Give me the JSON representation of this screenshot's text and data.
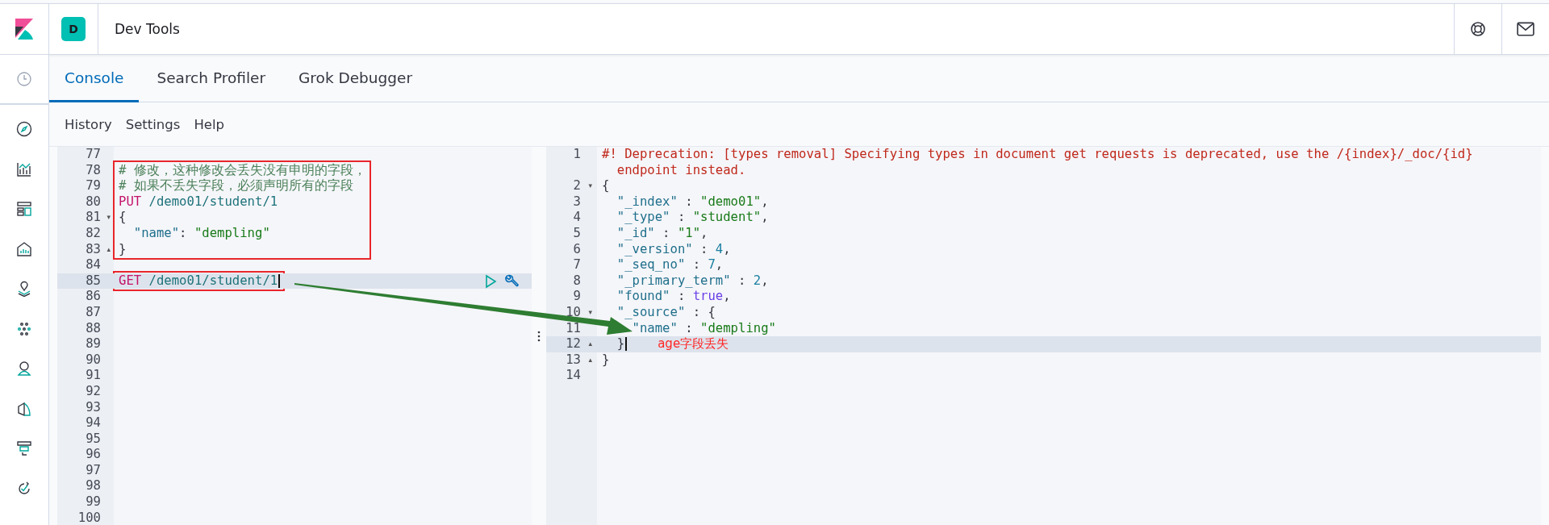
{
  "header": {
    "avatar": "D",
    "title": "Dev Tools"
  },
  "tabs": [
    {
      "label": "Console",
      "selected": true
    },
    {
      "label": "Search Profiler",
      "selected": false
    },
    {
      "label": "Grok Debugger",
      "selected": false
    }
  ],
  "menu": [
    "History",
    "Settings",
    "Help"
  ],
  "request_editor": {
    "blocks": [
      {
        "boxed": false,
        "lines": [
          {
            "number": "77",
            "active": false
          }
        ]
      },
      {
        "boxed": true,
        "lines": [
          {
            "number": "78",
            "active": false,
            "tokens": [
              {
                "kind": "comment",
                "text": "# 修改，这种修改会丢失没有申明的字段，"
              }
            ]
          },
          {
            "number": "79",
            "active": false,
            "tokens": [
              {
                "kind": "comment",
                "text": "# 如果不丢失字段，必须声明所有的字段"
              }
            ]
          },
          {
            "number": "80",
            "active": false,
            "tokens": [
              {
                "kind": "method",
                "text": "PUT"
              },
              {
                "kind": "path",
                "text": " /demo01/student/1"
              }
            ]
          },
          {
            "number": "81",
            "active": false,
            "fold": "▾",
            "tokens": [
              {
                "kind": "punct",
                "text": "{"
              }
            ]
          },
          {
            "number": "82",
            "active": false,
            "tokens": [
              {
                "kind": "key",
                "text": "  \"name\""
              },
              {
                "kind": "punct",
                "text": ": "
              },
              {
                "kind": "string",
                "text": "\"dempling\""
              }
            ]
          },
          {
            "number": "83",
            "active": false,
            "fold": "▴",
            "tokens": [
              {
                "kind": "punct",
                "text": "}"
              }
            ]
          }
        ]
      },
      {
        "boxed": false,
        "lines": [
          {
            "number": "84",
            "active": false
          }
        ]
      },
      {
        "boxed": true,
        "lines": [
          {
            "number": "85",
            "active": true,
            "tokens": [
              {
                "kind": "method",
                "text": "GET"
              },
              {
                "kind": "path",
                "text": " /demo01/student/1"
              }
            ]
          }
        ]
      },
      {
        "boxed": false,
        "lines": [
          {
            "number": "86",
            "active": false
          },
          {
            "number": "87",
            "active": false
          },
          {
            "number": "88",
            "active": false
          },
          {
            "number": "89",
            "active": false
          },
          {
            "number": "90",
            "active": false
          },
          {
            "number": "91",
            "active": false
          },
          {
            "number": "92",
            "active": false
          },
          {
            "number": "93",
            "active": false
          },
          {
            "number": "94",
            "active": false
          },
          {
            "number": "95",
            "active": false
          },
          {
            "number": "96",
            "active": false
          },
          {
            "number": "97",
            "active": false
          },
          {
            "number": "98",
            "active": false
          },
          {
            "number": "99",
            "active": false
          },
          {
            "number": "100",
            "active": false
          }
        ]
      }
    ]
  },
  "response_editor": {
    "lines": [
      {
        "number": "1",
        "active": false,
        "tokens": [
          {
            "kind": "error",
            "text": "#! Deprecation: [types removal] Specifying types in document get requests is deprecated, use the /{index}/_doc/{id}"
          }
        ],
        "wrap_tokens": [
          {
            "kind": "error",
            "text": "endpoint instead."
          }
        ]
      },
      {
        "number": "2",
        "active": false,
        "fold": "▾",
        "tokens": [
          {
            "kind": "punct",
            "text": "{"
          }
        ]
      },
      {
        "number": "3",
        "active": false,
        "tokens": [
          {
            "kind": "key",
            "text": "  \"_index\""
          },
          {
            "kind": "punct",
            "text": " : "
          },
          {
            "kind": "string",
            "text": "\"demo01\""
          },
          {
            "kind": "punct",
            "text": ","
          }
        ]
      },
      {
        "number": "4",
        "active": false,
        "tokens": [
          {
            "kind": "key",
            "text": "  \"_type\""
          },
          {
            "kind": "punct",
            "text": " : "
          },
          {
            "kind": "string",
            "text": "\"student\""
          },
          {
            "kind": "punct",
            "text": ","
          }
        ]
      },
      {
        "number": "5",
        "active": false,
        "tokens": [
          {
            "kind": "key",
            "text": "  \"_id\""
          },
          {
            "kind": "punct",
            "text": " : "
          },
          {
            "kind": "string",
            "text": "\"1\""
          },
          {
            "kind": "punct",
            "text": ","
          }
        ]
      },
      {
        "number": "6",
        "active": false,
        "tokens": [
          {
            "kind": "key",
            "text": "  \"_version\""
          },
          {
            "kind": "punct",
            "text": " : "
          },
          {
            "kind": "number",
            "text": "4"
          },
          {
            "kind": "punct",
            "text": ","
          }
        ]
      },
      {
        "number": "7",
        "active": false,
        "tokens": [
          {
            "kind": "key",
            "text": "  \"_seq_no\""
          },
          {
            "kind": "punct",
            "text": " : "
          },
          {
            "kind": "number",
            "text": "7"
          },
          {
            "kind": "punct",
            "text": ","
          }
        ]
      },
      {
        "number": "8",
        "active": false,
        "tokens": [
          {
            "kind": "key",
            "text": "  \"_primary_term\""
          },
          {
            "kind": "punct",
            "text": " : "
          },
          {
            "kind": "number",
            "text": "2"
          },
          {
            "kind": "punct",
            "text": ","
          }
        ]
      },
      {
        "number": "9",
        "active": false,
        "tokens": [
          {
            "kind": "key",
            "text": "  \"found\""
          },
          {
            "kind": "punct",
            "text": " : "
          },
          {
            "kind": "bool",
            "text": "true"
          },
          {
            "kind": "punct",
            "text": ","
          }
        ]
      },
      {
        "number": "10",
        "active": false,
        "fold": "▾",
        "tokens": [
          {
            "kind": "key",
            "text": "  \"_source\""
          },
          {
            "kind": "punct",
            "text": " : {"
          }
        ]
      },
      {
        "number": "11",
        "active": false,
        "tokens": [
          {
            "kind": "key",
            "text": "    \"name\""
          },
          {
            "kind": "punct",
            "text": " : "
          },
          {
            "kind": "string",
            "text": "\"dempling\""
          }
        ]
      },
      {
        "number": "12",
        "active": true,
        "fold": "▴",
        "tokens": [
          {
            "kind": "punct",
            "text": "  }"
          }
        ],
        "note": "age字段丢失"
      },
      {
        "number": "13",
        "active": false,
        "fold": "▴",
        "tokens": [
          {
            "kind": "punct",
            "text": "}"
          }
        ]
      },
      {
        "number": "14",
        "active": false
      }
    ]
  }
}
